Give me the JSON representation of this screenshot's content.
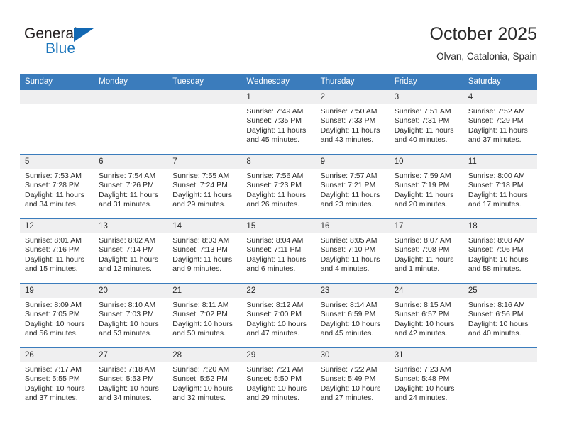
{
  "brand": {
    "name_part1": "General",
    "name_part2": "Blue"
  },
  "header": {
    "title": "October 2025",
    "location": "Olvan, Catalonia, Spain"
  },
  "colors": {
    "header_blue": "#3b7cbc",
    "daynum_gray": "#efeff0",
    "text": "#2b2b2b",
    "brand_blue": "#1b75bb"
  },
  "weekdays": [
    "Sunday",
    "Monday",
    "Tuesday",
    "Wednesday",
    "Thursday",
    "Friday",
    "Saturday"
  ],
  "weeks": [
    {
      "days": [
        {
          "num": "",
          "sunrise": "",
          "sunset": "",
          "daylight": ""
        },
        {
          "num": "",
          "sunrise": "",
          "sunset": "",
          "daylight": ""
        },
        {
          "num": "",
          "sunrise": "",
          "sunset": "",
          "daylight": ""
        },
        {
          "num": "1",
          "sunrise": "Sunrise: 7:49 AM",
          "sunset": "Sunset: 7:35 PM",
          "daylight": "Daylight: 11 hours and 45 minutes."
        },
        {
          "num": "2",
          "sunrise": "Sunrise: 7:50 AM",
          "sunset": "Sunset: 7:33 PM",
          "daylight": "Daylight: 11 hours and 43 minutes."
        },
        {
          "num": "3",
          "sunrise": "Sunrise: 7:51 AM",
          "sunset": "Sunset: 7:31 PM",
          "daylight": "Daylight: 11 hours and 40 minutes."
        },
        {
          "num": "4",
          "sunrise": "Sunrise: 7:52 AM",
          "sunset": "Sunset: 7:29 PM",
          "daylight": "Daylight: 11 hours and 37 minutes."
        }
      ]
    },
    {
      "days": [
        {
          "num": "5",
          "sunrise": "Sunrise: 7:53 AM",
          "sunset": "Sunset: 7:28 PM",
          "daylight": "Daylight: 11 hours and 34 minutes."
        },
        {
          "num": "6",
          "sunrise": "Sunrise: 7:54 AM",
          "sunset": "Sunset: 7:26 PM",
          "daylight": "Daylight: 11 hours and 31 minutes."
        },
        {
          "num": "7",
          "sunrise": "Sunrise: 7:55 AM",
          "sunset": "Sunset: 7:24 PM",
          "daylight": "Daylight: 11 hours and 29 minutes."
        },
        {
          "num": "8",
          "sunrise": "Sunrise: 7:56 AM",
          "sunset": "Sunset: 7:23 PM",
          "daylight": "Daylight: 11 hours and 26 minutes."
        },
        {
          "num": "9",
          "sunrise": "Sunrise: 7:57 AM",
          "sunset": "Sunset: 7:21 PM",
          "daylight": "Daylight: 11 hours and 23 minutes."
        },
        {
          "num": "10",
          "sunrise": "Sunrise: 7:59 AM",
          "sunset": "Sunset: 7:19 PM",
          "daylight": "Daylight: 11 hours and 20 minutes."
        },
        {
          "num": "11",
          "sunrise": "Sunrise: 8:00 AM",
          "sunset": "Sunset: 7:18 PM",
          "daylight": "Daylight: 11 hours and 17 minutes."
        }
      ]
    },
    {
      "days": [
        {
          "num": "12",
          "sunrise": "Sunrise: 8:01 AM",
          "sunset": "Sunset: 7:16 PM",
          "daylight": "Daylight: 11 hours and 15 minutes."
        },
        {
          "num": "13",
          "sunrise": "Sunrise: 8:02 AM",
          "sunset": "Sunset: 7:14 PM",
          "daylight": "Daylight: 11 hours and 12 minutes."
        },
        {
          "num": "14",
          "sunrise": "Sunrise: 8:03 AM",
          "sunset": "Sunset: 7:13 PM",
          "daylight": "Daylight: 11 hours and 9 minutes."
        },
        {
          "num": "15",
          "sunrise": "Sunrise: 8:04 AM",
          "sunset": "Sunset: 7:11 PM",
          "daylight": "Daylight: 11 hours and 6 minutes."
        },
        {
          "num": "16",
          "sunrise": "Sunrise: 8:05 AM",
          "sunset": "Sunset: 7:10 PM",
          "daylight": "Daylight: 11 hours and 4 minutes."
        },
        {
          "num": "17",
          "sunrise": "Sunrise: 8:07 AM",
          "sunset": "Sunset: 7:08 PM",
          "daylight": "Daylight: 11 hours and 1 minute."
        },
        {
          "num": "18",
          "sunrise": "Sunrise: 8:08 AM",
          "sunset": "Sunset: 7:06 PM",
          "daylight": "Daylight: 10 hours and 58 minutes."
        }
      ]
    },
    {
      "days": [
        {
          "num": "19",
          "sunrise": "Sunrise: 8:09 AM",
          "sunset": "Sunset: 7:05 PM",
          "daylight": "Daylight: 10 hours and 56 minutes."
        },
        {
          "num": "20",
          "sunrise": "Sunrise: 8:10 AM",
          "sunset": "Sunset: 7:03 PM",
          "daylight": "Daylight: 10 hours and 53 minutes."
        },
        {
          "num": "21",
          "sunrise": "Sunrise: 8:11 AM",
          "sunset": "Sunset: 7:02 PM",
          "daylight": "Daylight: 10 hours and 50 minutes."
        },
        {
          "num": "22",
          "sunrise": "Sunrise: 8:12 AM",
          "sunset": "Sunset: 7:00 PM",
          "daylight": "Daylight: 10 hours and 47 minutes."
        },
        {
          "num": "23",
          "sunrise": "Sunrise: 8:14 AM",
          "sunset": "Sunset: 6:59 PM",
          "daylight": "Daylight: 10 hours and 45 minutes."
        },
        {
          "num": "24",
          "sunrise": "Sunrise: 8:15 AM",
          "sunset": "Sunset: 6:57 PM",
          "daylight": "Daylight: 10 hours and 42 minutes."
        },
        {
          "num": "25",
          "sunrise": "Sunrise: 8:16 AM",
          "sunset": "Sunset: 6:56 PM",
          "daylight": "Daylight: 10 hours and 40 minutes."
        }
      ]
    },
    {
      "days": [
        {
          "num": "26",
          "sunrise": "Sunrise: 7:17 AM",
          "sunset": "Sunset: 5:55 PM",
          "daylight": "Daylight: 10 hours and 37 minutes."
        },
        {
          "num": "27",
          "sunrise": "Sunrise: 7:18 AM",
          "sunset": "Sunset: 5:53 PM",
          "daylight": "Daylight: 10 hours and 34 minutes."
        },
        {
          "num": "28",
          "sunrise": "Sunrise: 7:20 AM",
          "sunset": "Sunset: 5:52 PM",
          "daylight": "Daylight: 10 hours and 32 minutes."
        },
        {
          "num": "29",
          "sunrise": "Sunrise: 7:21 AM",
          "sunset": "Sunset: 5:50 PM",
          "daylight": "Daylight: 10 hours and 29 minutes."
        },
        {
          "num": "30",
          "sunrise": "Sunrise: 7:22 AM",
          "sunset": "Sunset: 5:49 PM",
          "daylight": "Daylight: 10 hours and 27 minutes."
        },
        {
          "num": "31",
          "sunrise": "Sunrise: 7:23 AM",
          "sunset": "Sunset: 5:48 PM",
          "daylight": "Daylight: 10 hours and 24 minutes."
        },
        {
          "num": "",
          "sunrise": "",
          "sunset": "",
          "daylight": ""
        }
      ]
    }
  ]
}
